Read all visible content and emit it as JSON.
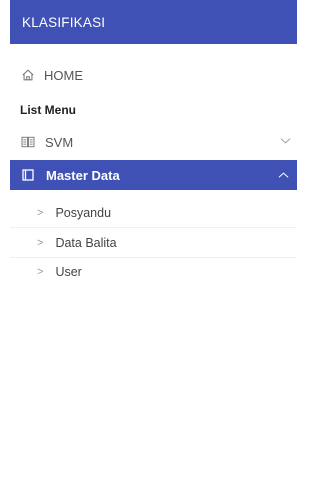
{
  "brand": {
    "title": "KLASIFIKASI",
    "color": "#3f51b5"
  },
  "nav": {
    "home": {
      "label": "HOME",
      "icon": "home-icon"
    },
    "section_label": "List Menu",
    "svm": {
      "label": "SVM",
      "icon": "book-icon",
      "expanded": false
    },
    "master_data": {
      "label": "Master Data",
      "icon": "folder-icon",
      "expanded": true,
      "active": true,
      "items": [
        {
          "label": "Posyandu",
          "icon": "chevron-right-icon"
        },
        {
          "label": "Data Balita",
          "icon": "chevron-right-icon"
        },
        {
          "label": "User",
          "icon": "chevron-right-icon"
        }
      ]
    }
  }
}
